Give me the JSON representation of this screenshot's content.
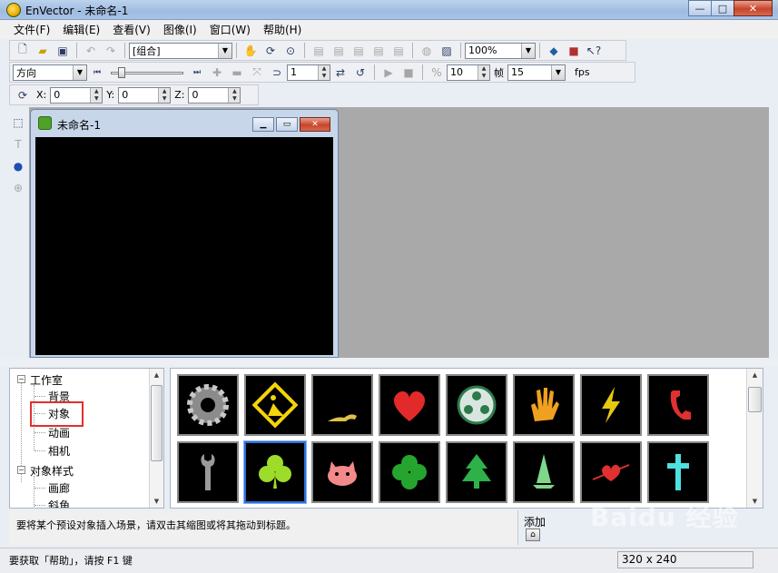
{
  "window": {
    "title": "EnVector - 未命名-1",
    "min": "—",
    "max": "□",
    "close": "✕"
  },
  "menu": [
    "文件(F)",
    "编辑(E)",
    "查看(V)",
    "图像(I)",
    "窗口(W)",
    "帮助(H)"
  ],
  "toolbar1": {
    "group_select": "[组合]",
    "zoom": "100%"
  },
  "toolbar2": {
    "direction": "方向",
    "steps": "1",
    "frames": "10",
    "frames_label": "帧",
    "fps": "15",
    "fps_label": "fps"
  },
  "toolbar3": {
    "x_label": "X:",
    "x": "0",
    "y_label": "Y:",
    "y": "0",
    "z_label": "Z:",
    "z": "0"
  },
  "document": {
    "title": "未命名-1"
  },
  "tree": {
    "root": "工作室",
    "children": [
      "背景",
      "对象",
      "动画",
      "相机"
    ],
    "root2": "对象样式",
    "children2": [
      "画廊",
      "斜角"
    ]
  },
  "gallery": {
    "items": [
      {
        "name": "gear"
      },
      {
        "name": "construction-sign"
      },
      {
        "name": "kangaroo"
      },
      {
        "name": "heart"
      },
      {
        "name": "film-reel"
      },
      {
        "name": "hand"
      },
      {
        "name": "lightning"
      },
      {
        "name": "telephone"
      },
      {
        "name": "wrench"
      },
      {
        "name": "shamrock"
      },
      {
        "name": "cat-face"
      },
      {
        "name": "four-leaf-clover"
      },
      {
        "name": "tree"
      },
      {
        "name": "sailboat"
      },
      {
        "name": "heart-arrow"
      },
      {
        "name": "cross"
      }
    ],
    "selected_index": 9
  },
  "hint": "要将某个预设对象插入场景，请双击其缩图或将其拖动到标题。",
  "add": {
    "label": "添加"
  },
  "status": {
    "help": "要获取「帮助」，请按 F1 键",
    "size": "320 x 240"
  },
  "watermark": "Baidu 经验"
}
